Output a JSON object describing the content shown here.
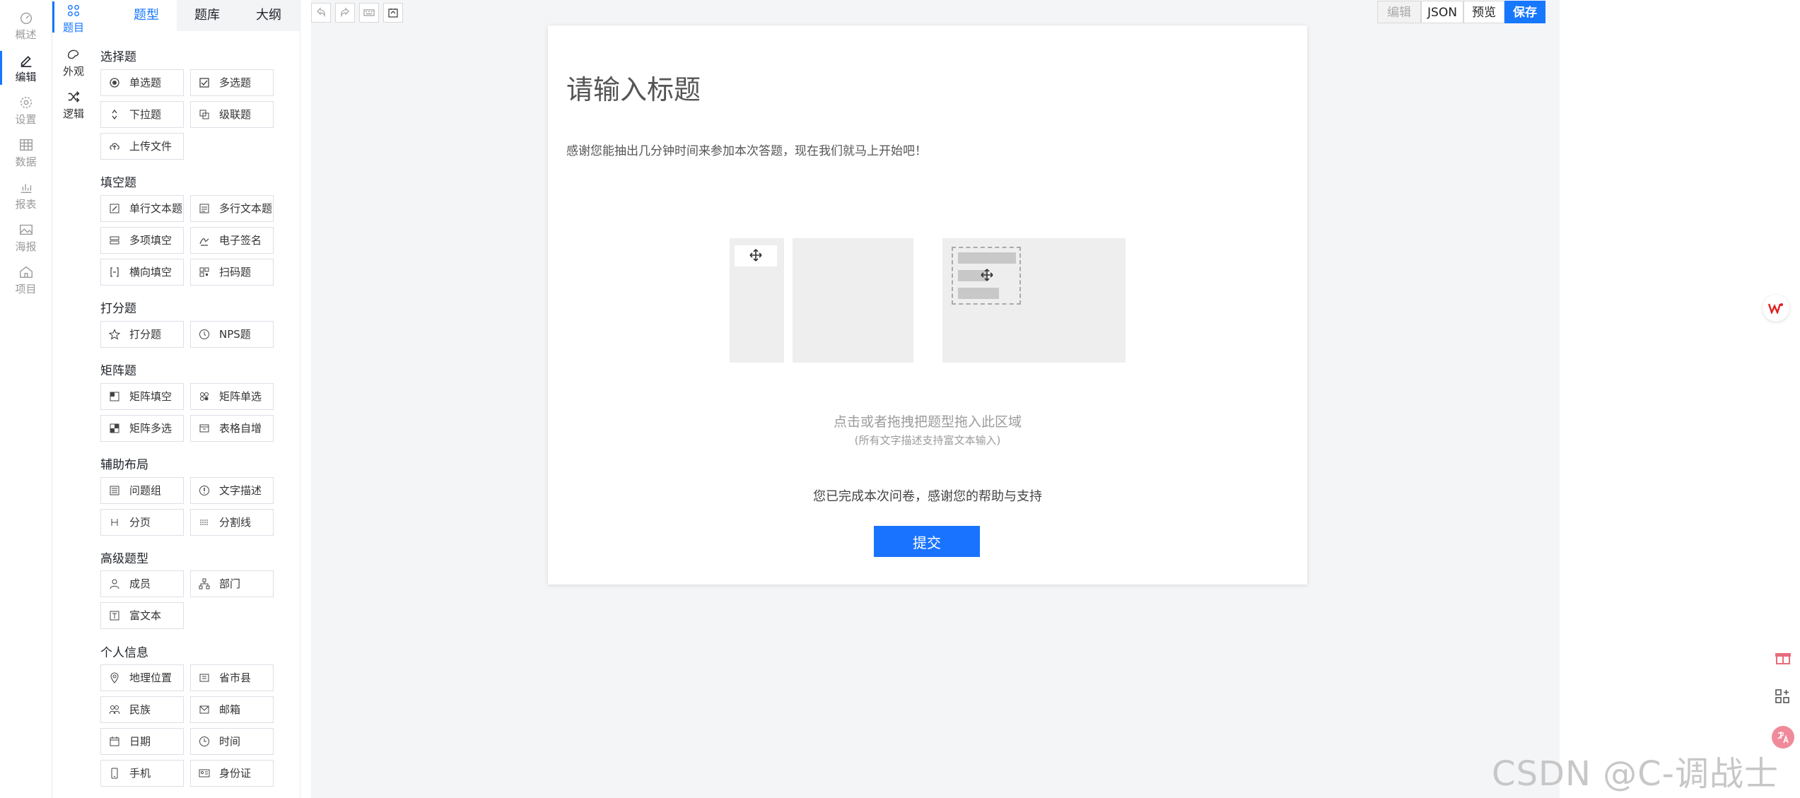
{
  "rail": [
    {
      "label": "概述",
      "icon": "dashboard-icon"
    },
    {
      "label": "编辑",
      "icon": "pen-icon",
      "active": true
    },
    {
      "label": "设置",
      "icon": "gear-icon"
    },
    {
      "label": "数据",
      "icon": "table-icon"
    },
    {
      "label": "报表",
      "icon": "chart-icon"
    },
    {
      "label": "海报",
      "icon": "image-icon"
    },
    {
      "label": "项目",
      "icon": "home-icon"
    }
  ],
  "rail2": [
    {
      "label": "题目",
      "icon": "grid-icon",
      "active": true
    },
    {
      "label": "外观",
      "icon": "palette-icon"
    },
    {
      "label": "逻辑",
      "icon": "shuffle-icon"
    }
  ],
  "tabs": [
    {
      "label": "题型",
      "active": true
    },
    {
      "label": "题库"
    },
    {
      "label": "大纲"
    }
  ],
  "sections": [
    {
      "title": "选择题",
      "items": [
        {
          "label": "单选题",
          "icon": "radio-icon"
        },
        {
          "label": "多选题",
          "icon": "checkbox-icon"
        },
        {
          "label": "下拉题",
          "icon": "dropdown-icon"
        },
        {
          "label": "级联题",
          "icon": "cascade-icon"
        },
        {
          "label": "上传文件",
          "icon": "upload-icon"
        }
      ]
    },
    {
      "title": "填空题",
      "items": [
        {
          "label": "单行文本题",
          "icon": "edit-icon"
        },
        {
          "label": "多行文本题",
          "icon": "textarea-icon"
        },
        {
          "label": "多项填空",
          "icon": "multi-fill-icon"
        },
        {
          "label": "电子签名",
          "icon": "signature-icon"
        },
        {
          "label": "横向填空",
          "icon": "bracket-icon"
        },
        {
          "label": "扫码题",
          "icon": "qrcode-icon"
        }
      ]
    },
    {
      "title": "打分题",
      "items": [
        {
          "label": "打分题",
          "icon": "star-icon"
        },
        {
          "label": "NPS题",
          "icon": "nps-icon"
        }
      ]
    },
    {
      "title": "矩阵题",
      "items": [
        {
          "label": "矩阵填空",
          "icon": "matrix-fill-icon"
        },
        {
          "label": "矩阵单选",
          "icon": "matrix-radio-icon"
        },
        {
          "label": "矩阵多选",
          "icon": "matrix-check-icon"
        },
        {
          "label": "表格自增",
          "icon": "table-add-icon"
        }
      ]
    },
    {
      "title": "辅助布局",
      "items": [
        {
          "label": "问题组",
          "icon": "group-icon"
        },
        {
          "label": "文字描述",
          "icon": "info-icon"
        },
        {
          "label": "分页",
          "icon": "pagination-icon"
        },
        {
          "label": "分割线",
          "icon": "divider-icon"
        }
      ]
    },
    {
      "title": "高级题型",
      "items": [
        {
          "label": "成员",
          "icon": "user-icon"
        },
        {
          "label": "部门",
          "icon": "org-icon"
        },
        {
          "label": "富文本",
          "icon": "richtext-icon"
        }
      ]
    },
    {
      "title": "个人信息",
      "items": [
        {
          "label": "地理位置",
          "icon": "location-icon"
        },
        {
          "label": "省市县",
          "icon": "region-icon"
        },
        {
          "label": "民族",
          "icon": "people-icon"
        },
        {
          "label": "邮箱",
          "icon": "mail-icon"
        },
        {
          "label": "日期",
          "icon": "calendar-icon"
        },
        {
          "label": "时间",
          "icon": "clock-icon"
        },
        {
          "label": "手机",
          "icon": "phone-icon"
        },
        {
          "label": "身份证",
          "icon": "idcard-icon"
        }
      ]
    }
  ],
  "toolbar": {
    "edit_label": "编辑",
    "json_label": "JSON",
    "preview_label": "预览",
    "save_label": "保存",
    "accent": "#1677ff"
  },
  "paper": {
    "title": "请输入标题",
    "description": "感谢您能抽出几分钟时间来参加本次答题，现在我们就马上开始吧！",
    "drop_hint": "点击或者拖拽把题型拖入此区域",
    "drop_sub": "(所有文字描述支持富文本输入)",
    "done_text": "您已完成本次问卷，感谢您的帮助与支持",
    "submit_label": "提交"
  },
  "watermark": "CSDN @C-调战士"
}
